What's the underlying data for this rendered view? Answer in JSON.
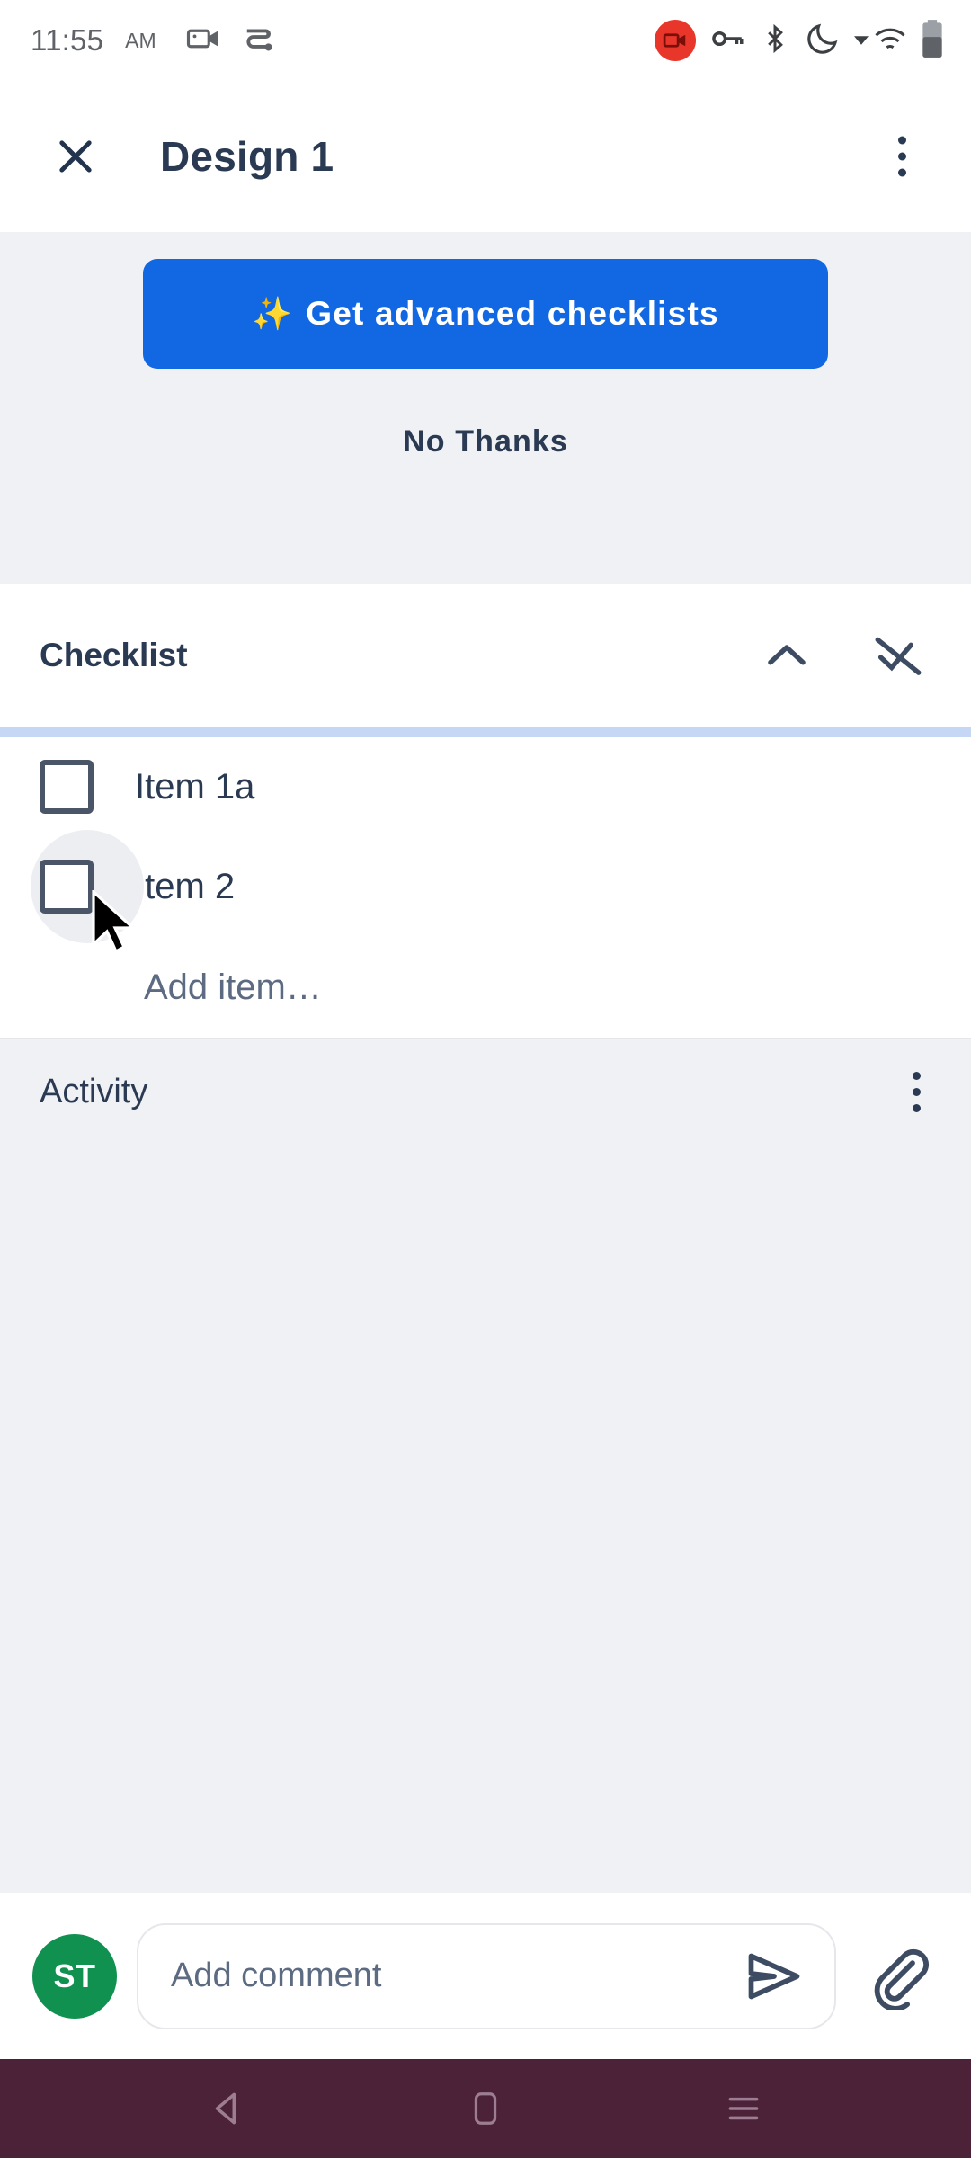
{
  "status_bar": {
    "time": "11:55",
    "ampm": "AM",
    "left_icons": [
      "screen-record-icon",
      "data-saver-icon"
    ],
    "right_icons": [
      "recording-badge-icon",
      "vpn-key-icon",
      "bluetooth-icon",
      "do-not-disturb-icon",
      "wifi-icon",
      "battery-icon"
    ]
  },
  "app_bar": {
    "close_label": "✕",
    "title": "Design 1",
    "overflow_label": "More options"
  },
  "promo": {
    "sparkle": "✨",
    "cta_label": "Get advanced checklists",
    "dismiss_label": "No Thanks",
    "accent_color": "#1268E3",
    "background_color": "#F0F1F4"
  },
  "checklist": {
    "title": "Checklist",
    "collapse_icon": "chevron-up-icon",
    "hide_checked_icon": "hide-checked-items-icon",
    "divider_color": "#C6D6F5",
    "items": [
      {
        "label": "Item 1a",
        "checked": false
      },
      {
        "label": "Item 2",
        "checked": false
      }
    ],
    "add_item_placeholder": "Add item…"
  },
  "activity": {
    "title": "Activity",
    "overflow_label": "Activity options",
    "entries": []
  },
  "comment_bar": {
    "avatar_initials": "ST",
    "avatar_color": "#119150",
    "placeholder": "Add comment",
    "send_icon": "send-icon",
    "attach_icon": "paperclip-icon"
  },
  "nav_bar": {
    "background_color": "#4B2238",
    "back_label": "Back",
    "home_label": "Home",
    "recents_label": "Recent apps"
  }
}
